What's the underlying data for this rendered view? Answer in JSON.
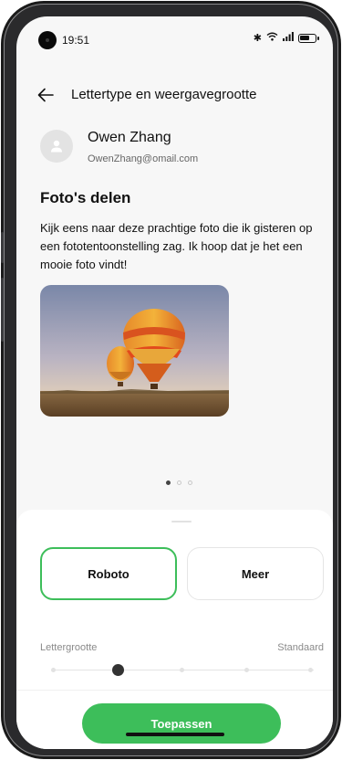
{
  "status_bar": {
    "time": "19:51",
    "icons": [
      "bluetooth-icon",
      "wifi-icon",
      "signal-icon",
      "battery-icon"
    ]
  },
  "header": {
    "back_icon": "arrow-left-icon",
    "title": "Lettertype en weergavegrootte"
  },
  "preview": {
    "sender_name": "Owen Zhang",
    "sender_email": "OwenZhang@omail.com",
    "post_title": "Foto's delen",
    "post_body": "Kijk eens naar deze prachtige foto die ik gisteren op een fototentoonstelling zag. Ik hoop dat je het een mooie foto vindt!",
    "image_subject": "hot-air-balloons-photo",
    "page_indicator": {
      "count": 3,
      "active_index": 0
    }
  },
  "sheet": {
    "fonts": [
      {
        "label": "Roboto",
        "selected": true
      },
      {
        "label": "Meer",
        "selected": false
      }
    ],
    "size_label": "Lettergrootte",
    "size_value": "Standaard",
    "size_slider": {
      "steps": 5,
      "selected_index": 1
    },
    "apply_label": "Toepassen"
  },
  "colors": {
    "accent": "#3dbe5a",
    "text_primary": "#111111",
    "text_secondary": "#8a8a8a",
    "background": "#f7f7f7"
  }
}
